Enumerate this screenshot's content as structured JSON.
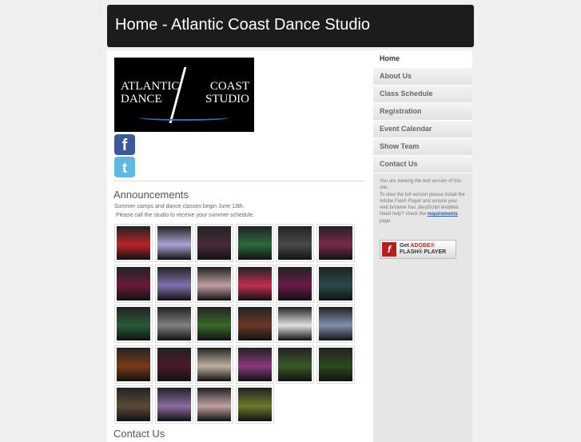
{
  "header": {
    "title": "Home - Atlantic Coast Dance Studio"
  },
  "logo": {
    "left": "ATLANTIC DANCE",
    "right": "COAST STUDIO"
  },
  "social": {
    "facebook": "f",
    "twitter": "t"
  },
  "announcements": {
    "title": "Announcements",
    "line1": "Summer camps and dance classes begin June 13th.",
    "line2": " Please call the studio to receive your summer schedule."
  },
  "gallery": [
    "#b8242a",
    "#a9a5d6",
    "#4a2a3a",
    "#2d6a3e",
    "#4a4a4a",
    "#7a2a4a",
    "#6a1a3a",
    "#8070b0",
    "#c0a0a0",
    "#c03050",
    "#6a1a4a",
    "#2a4a4a",
    "#2a5a3a",
    "#808080",
    "#3a6a2a",
    "#6a3a2a",
    "#e0e0e0",
    "#8090b0",
    "#7a3a1a",
    "#4a1a2a",
    "#c0b0a0",
    "#8a3a7a",
    "#3a5a2a",
    "#2a4a1a",
    "#5a4a3a",
    "#8a6aa0",
    "#c0a0a0",
    "#6a7a2a"
  ],
  "contact": {
    "title": "Contact Us"
  },
  "nav": [
    "Home",
    "About Us",
    "Class Schedule",
    "Registration",
    "Event Calendar",
    "Show Team",
    "Contact Us"
  ],
  "sidebar": {
    "info1": "You are viewing the text version of this site.",
    "info2": "To view the full version please install the Adobe Flash Player and ensure your web browser has JavaScript enabled.",
    "info3": "Need help? check the ",
    "link": "requirements",
    "info4": " page.",
    "flash_get": "Get ",
    "flash_adobe": "ADOBE®",
    "flash_player": "FLASH® PLAYER"
  }
}
